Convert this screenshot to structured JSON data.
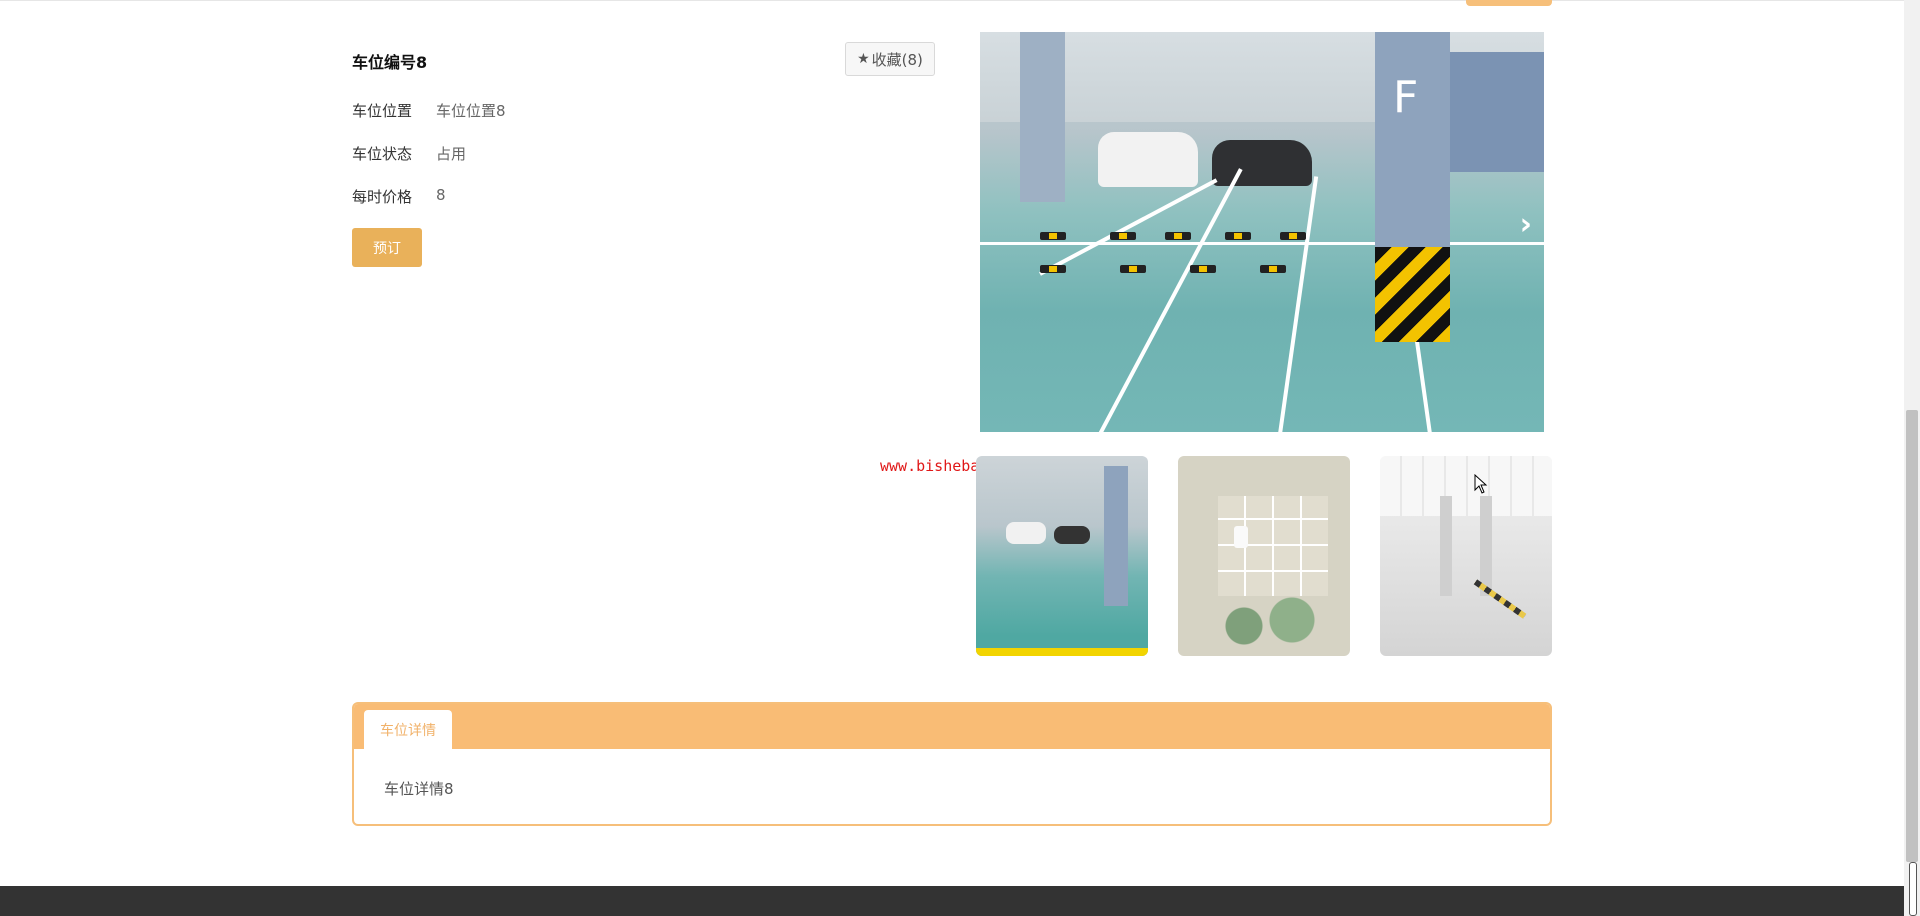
{
  "detail": {
    "title": "车位编号8",
    "favorite_label": "收藏(8)",
    "fields": [
      {
        "label": "车位位置",
        "value": "车位位置8"
      },
      {
        "label": "车位状态",
        "value": "占用"
      },
      {
        "label": "每时价格",
        "value": "8"
      }
    ],
    "book_label": "预订"
  },
  "watermark": "www.bishebang.site",
  "tabs": {
    "active_label": "车位详情",
    "content": "车位详情8"
  },
  "colors": {
    "accent": "#e9b15a",
    "tab_header": "#f9bc75",
    "footer": "#333333"
  },
  "icons": [
    "star-icon",
    "chevron-right-icon"
  ]
}
